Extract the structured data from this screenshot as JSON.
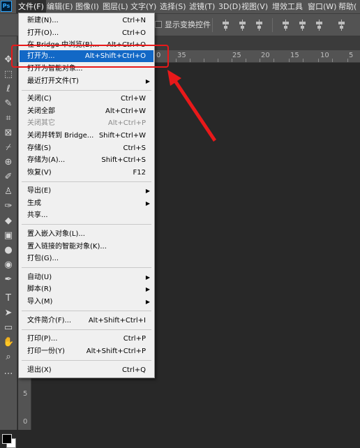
{
  "app": {
    "logo": "Ps"
  },
  "menubar": {
    "items": [
      "文件(F)",
      "编辑(E)",
      "图像(I)",
      "图层(L)",
      "文字(Y)",
      "选择(S)",
      "滤镜(T)",
      "3D(D)",
      "视图(V)",
      "增效工具",
      "窗口(W)",
      "帮助("
    ],
    "active_index": 0
  },
  "options": {
    "show_transform_label": "显示变换控件"
  },
  "ruler": {
    "top_labels": [
      "0",
      "35",
      "25",
      "20",
      "15",
      "10",
      "5"
    ],
    "left_labels": [
      "5",
      "0"
    ]
  },
  "file_menu": {
    "groups": [
      [
        {
          "label": "新建(N)...",
          "shortcut": "Ctrl+N"
        },
        {
          "label": "打开(O)...",
          "shortcut": "Ctrl+O"
        },
        {
          "label": "在 Bridge 中浏览(B)...",
          "shortcut": "Alt+Ctrl+O"
        },
        {
          "label": "打开为...",
          "shortcut": "Alt+Shift+Ctrl+O",
          "highlighted": true
        },
        {
          "label": "打开为智能对象..."
        },
        {
          "label": "最近打开文件(T)",
          "submenu": true
        }
      ],
      [
        {
          "label": "关闭(C)",
          "shortcut": "Ctrl+W"
        },
        {
          "label": "关闭全部",
          "shortcut": "Alt+Ctrl+W"
        },
        {
          "label": "关闭其它",
          "shortcut": "Alt+Ctrl+P",
          "disabled": true
        },
        {
          "label": "关闭并转到 Bridge...",
          "shortcut": "Shift+Ctrl+W"
        },
        {
          "label": "存储(S)",
          "shortcut": "Ctrl+S"
        },
        {
          "label": "存储为(A)...",
          "shortcut": "Shift+Ctrl+S"
        },
        {
          "label": "恢复(V)",
          "shortcut": "F12"
        }
      ],
      [
        {
          "label": "导出(E)",
          "submenu": true
        },
        {
          "label": "生成",
          "submenu": true
        },
        {
          "label": "共享..."
        }
      ],
      [
        {
          "label": "置入嵌入对象(L)..."
        },
        {
          "label": "置入链接的智能对象(K)..."
        },
        {
          "label": "打包(G)..."
        }
      ],
      [
        {
          "label": "自动(U)",
          "submenu": true
        },
        {
          "label": "脚本(R)",
          "submenu": true
        },
        {
          "label": "导入(M)",
          "submenu": true
        }
      ],
      [
        {
          "label": "文件简介(F)...",
          "shortcut": "Alt+Shift+Ctrl+I"
        }
      ],
      [
        {
          "label": "打印(P)...",
          "shortcut": "Ctrl+P"
        },
        {
          "label": "打印一份(Y)",
          "shortcut": "Alt+Shift+Ctrl+P"
        }
      ],
      [
        {
          "label": "退出(X)",
          "shortcut": "Ctrl+Q"
        }
      ]
    ]
  },
  "colors": {
    "highlight": "#1268c6",
    "annotation": "#e8191a",
    "canvas": "#282828"
  },
  "toolbar": {
    "icons": [
      "move-icon",
      "marquee-icon",
      "lasso-icon",
      "quick-select-icon",
      "crop-icon",
      "frame-icon",
      "eyedropper-icon",
      "healing-icon",
      "brush-icon",
      "stamp-icon",
      "history-brush-icon",
      "eraser-icon",
      "gradient-icon",
      "blur-icon",
      "dodge-icon",
      "pen-icon",
      "type-icon",
      "path-select-icon",
      "shape-icon",
      "hand-icon",
      "zoom-icon"
    ]
  }
}
